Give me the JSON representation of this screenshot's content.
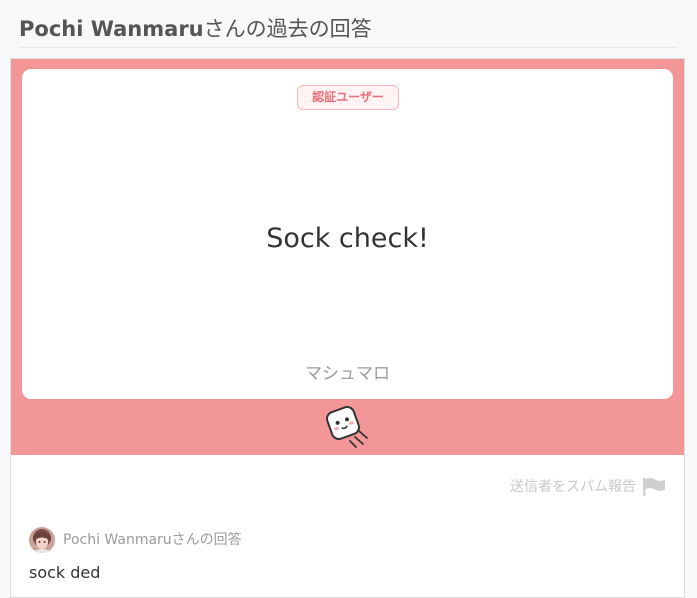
{
  "page": {
    "title_name": "Pochi Wanmaru",
    "title_suffix": "さんの過去の回答"
  },
  "question": {
    "badge": "認証ユーザー",
    "text": "Sock check!",
    "brand": "マシュマロ"
  },
  "actions": {
    "report_label": "送信者をスパム報告"
  },
  "answer": {
    "label": "Pochi Wanmaruさんの回答",
    "text": "sock ded"
  },
  "colors": {
    "card_pink": "#f29698",
    "badge_text": "#e8707c"
  },
  "icons": {
    "mascot": "marshmallow-mascot-icon",
    "report": "flag-icon"
  }
}
